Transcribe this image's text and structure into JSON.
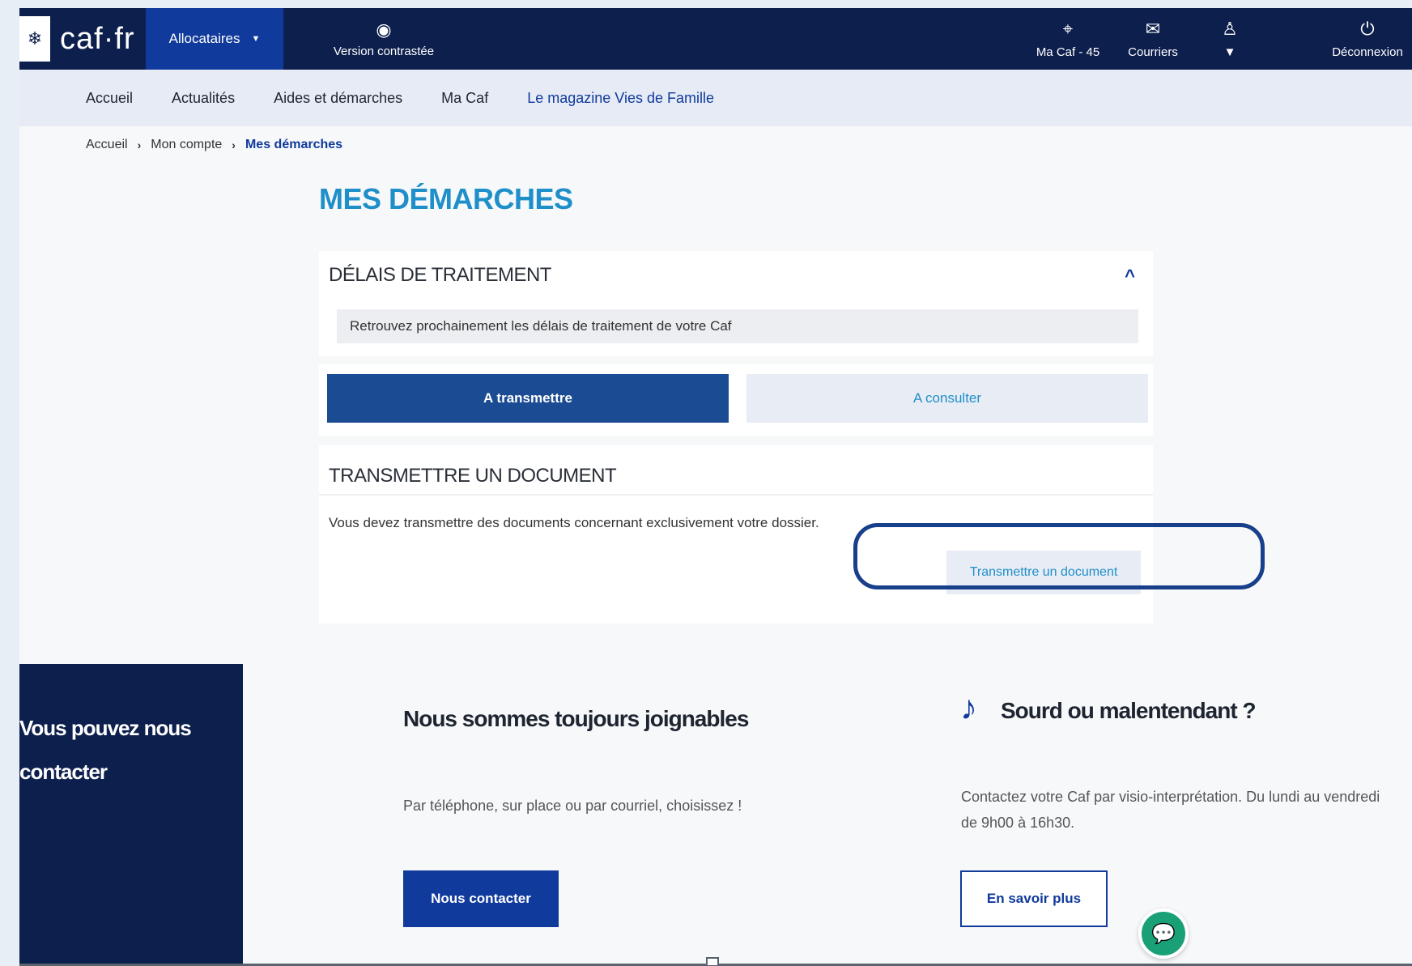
{
  "header": {
    "logo_text": "caf·fr",
    "logo_icon": "snowflake-icon",
    "allocataires_label": "Allocataires",
    "contrast_label": "Version contrastée",
    "contrast_icon": "eye-icon",
    "my_caf_label": "Ma Caf - 45",
    "my_caf_icon": "location-pin-icon",
    "mail_label": "Courriers",
    "mail_icon": "envelope-icon",
    "account_icon": "user-icon",
    "logout_label": "Déconnexion",
    "logout_icon": "power-icon"
  },
  "nav": {
    "items": [
      "Accueil",
      "Actualités",
      "Aides et démarches",
      "Ma Caf",
      "Le magazine Vies de Famille"
    ]
  },
  "breadcrumb": {
    "items": [
      "Accueil",
      "Mon compte",
      "Mes démarches"
    ]
  },
  "page": {
    "title": "MES DÉMARCHES"
  },
  "delais": {
    "title": "DÉLAIS DE TRAITEMENT",
    "info": "Retrouvez prochainement les délais de traitement de votre Caf"
  },
  "tabs": {
    "active": "A transmettre",
    "other": "A consulter"
  },
  "transmit": {
    "title": "TRANSMETTRE UN DOCUMENT",
    "text": "Vous devez transmettre des documents concernant exclusivement votre dossier.",
    "button": "Transmettre un document"
  },
  "contact": {
    "panel_title_line1": "Vous pouvez nous",
    "panel_title_line2": "contacter",
    "joignables_title": "Nous sommes toujours joignables",
    "joignables_text": "Par téléphone, sur place ou par courriel, choisissez !",
    "contact_button": "Nous contacter",
    "sourd_title": "Sourd ou malentendant ?",
    "sourd_text": "Contactez votre Caf par visio-interprétation. Du lundi au vendredi de 9h00 à 16h30.",
    "sourd_button": "En savoir plus",
    "sourd_icon": "ear-icon",
    "chat_icon": "chat-bubbles-icon"
  },
  "colors": {
    "navy": "#0d1f4d",
    "brand_blue": "#103a9c",
    "title_blue": "#1f8fc9",
    "chat_green": "#1aa077"
  }
}
